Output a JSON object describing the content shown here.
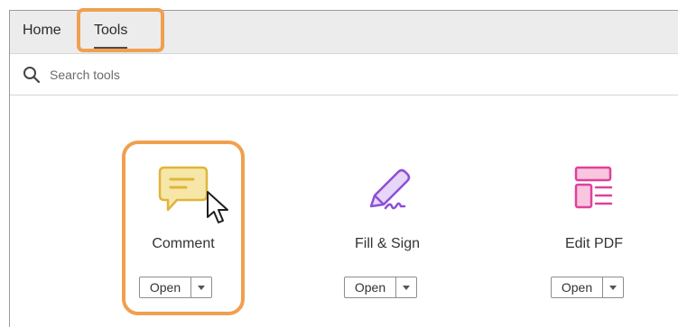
{
  "tabs": [
    {
      "label": "Home"
    },
    {
      "label": "Tools",
      "active": true
    }
  ],
  "search": {
    "placeholder": "Search tools",
    "value": ""
  },
  "tools": [
    {
      "label": "Comment",
      "icon": "comment-icon",
      "open_label": "Open",
      "color": "#e8c23e"
    },
    {
      "label": "Fill & Sign",
      "icon": "fill-sign-icon",
      "open_label": "Open",
      "color": "#8d4fd8"
    },
    {
      "label": "Edit PDF",
      "icon": "edit-pdf-icon",
      "open_label": "Open",
      "color": "#e0419a"
    }
  ],
  "highlight_color": "#f0a04e"
}
